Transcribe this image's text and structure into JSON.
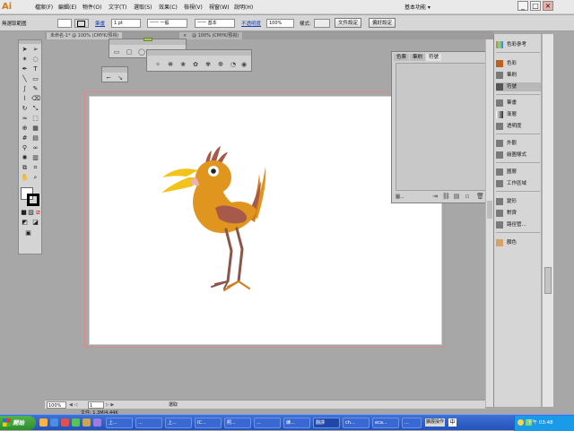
{
  "app": {
    "logo": "Ai"
  },
  "menubar": {
    "items": [
      "檔案(F)",
      "編輯(E)",
      "物件(O)",
      "文字(T)",
      "選取(S)",
      "效果(C)",
      "檢視(V)",
      "視窗(W)",
      "說明(H)"
    ],
    "workspace": "基本功能 ▾",
    "window_buttons": [
      "_",
      "□",
      "×"
    ]
  },
  "controlbar": {
    "selection_label": "無選取範圍",
    "stroke_label": "筆畫",
    "stroke_weight": "1 pt",
    "brush_label": "一一 一般",
    "style_label": "一一 基本",
    "opacity_label": "不透明度",
    "opacity_value": "100%",
    "style_field_label": "樣式:",
    "doc_setup_button": "文件設定",
    "prefs_button": "偏好設定"
  },
  "doctabs": [
    {
      "label": "未命名-1* @ 100% (CMYK/預視)"
    },
    {
      "label": "× "
    },
    {
      "label": "@ 100% (CMYK/預視)"
    }
  ],
  "midpanel": {
    "tabs": [
      "色票",
      "筆刷",
      "符號"
    ],
    "bottom_text": "圖..."
  },
  "dock": {
    "items": [
      {
        "label": "色彩參考",
        "icon": "color-guide-icon"
      },
      {
        "label": "色彩",
        "icon": "color-icon"
      },
      {
        "label": "筆刷",
        "icon": "brush-icon"
      },
      {
        "label": "符號",
        "icon": "symbol-icon"
      },
      {
        "label": "筆畫",
        "icon": "stroke-icon"
      },
      {
        "label": "漸層",
        "icon": "gradient-icon"
      },
      {
        "label": "透明度",
        "icon": "transparency-icon"
      },
      {
        "label": "外觀",
        "icon": "appearance-icon"
      },
      {
        "label": "繪圖樣式",
        "icon": "graphic-style-icon"
      },
      {
        "label": "圖層",
        "icon": "layers-icon"
      },
      {
        "label": "工作區域",
        "icon": "artboard-icon"
      },
      {
        "label": "變形",
        "icon": "transform-icon"
      },
      {
        "label": "對齊",
        "icon": "align-icon"
      },
      {
        "label": "路徑管...",
        "icon": "pathfinder-icon"
      },
      {
        "label": "顏色",
        "icon": "swatch-icon"
      }
    ]
  },
  "statusbar": {
    "zoom": "100%",
    "page": "1",
    "tool": "選取",
    "info": "文件: 1.3M/4.44K"
  },
  "taskbar": {
    "start": "開始",
    "items": [
      "上...",
      "...",
      "上...",
      "IC...",
      "照...",
      "...",
      "練...",
      "翻譯",
      "ch...",
      "eca...",
      "..."
    ],
    "language": "中",
    "clock": "下午 03:48",
    "status_text": "擴展操作"
  },
  "colors": {
    "accent": "#cf7c1b",
    "bird_body": "#e0951f",
    "bird_beak": "#f2c31d",
    "bird_wing": "#a85a4a",
    "bird_legs": "#8c5548",
    "artboard_border": "#d98b8b"
  }
}
